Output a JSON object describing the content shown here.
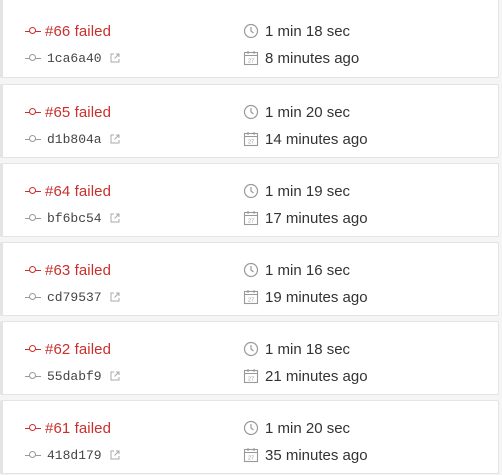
{
  "builds": [
    {
      "label": "#66 failed",
      "sha": "1ca6a40",
      "duration": "1 min 18 sec",
      "finished": "8 minutes ago"
    },
    {
      "label": "#65 failed",
      "sha": "d1b804a",
      "duration": "1 min 20 sec",
      "finished": "14 minutes ago"
    },
    {
      "label": "#64 failed",
      "sha": "bf6bc54",
      "duration": "1 min 19 sec",
      "finished": "17 minutes ago"
    },
    {
      "label": "#63 failed",
      "sha": "cd79537",
      "duration": "1 min 16 sec",
      "finished": "19 minutes ago"
    },
    {
      "label": "#62 failed",
      "sha": "55dabf9",
      "duration": "1 min 18 sec",
      "finished": "21 minutes ago"
    },
    {
      "label": "#61 failed",
      "sha": "418d179",
      "duration": "1 min 20 sec",
      "finished": "35 minutes ago"
    }
  ],
  "calendar_day": "27",
  "colors": {
    "failed": "#c9302c",
    "muted": "#999999"
  },
  "icons": {
    "build_status": "commit-icon",
    "commit": "commit-icon",
    "external": "external-link-icon",
    "duration": "clock-icon",
    "finished": "calendar-icon"
  }
}
